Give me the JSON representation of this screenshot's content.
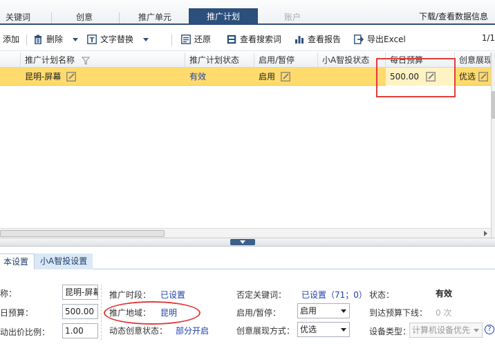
{
  "tabs": [
    {
      "label": "关键词"
    },
    {
      "label": "创意"
    },
    {
      "label": "推广单元"
    },
    {
      "label": "推广计划"
    },
    {
      "label": "账户"
    }
  ],
  "tabs_right_link": "下载/查看数据信息",
  "toolbar": {
    "add": "添加",
    "delete": "删除",
    "replace": "文字替换",
    "restore": "还原",
    "search_terms": "查看搜索词",
    "report": "查看报告",
    "export": "导出Excel",
    "pager": "1/1"
  },
  "grid": {
    "headers": [
      "推广计划名称",
      "推广计划状态",
      "启用/暂停",
      "小A智投状态",
      "每日预算",
      "创意展现"
    ],
    "row": {
      "name": "昆明-屏幕",
      "status": "有效",
      "enabled": "启用",
      "smart_status": "",
      "budget": "500.00",
      "creative": "优选"
    }
  },
  "bottom_tabs": [
    "本设置",
    "小A智投设置"
  ],
  "form": {
    "name_label": "称：",
    "name_value": "昆明-屏幕",
    "budget_label": "日预算：",
    "budget_value": "500.00",
    "bid_label": "动出价比例：",
    "bid_value": "1.00",
    "time_label": "推广时段：",
    "time_value": "已设置",
    "region_label": "推广地域：",
    "region_value": "昆明",
    "dynamic_label": "动态创意状态：",
    "dynamic_value": "部分开启",
    "negative_label": "否定关键词：",
    "negative_value": "已设置（71；0）",
    "pause_label": "启用/暂停：",
    "pause_value": "启用",
    "display_label": "创意展现方式：",
    "display_value": "优选",
    "status_label": "状态：",
    "status_value": "有效",
    "offline_label": "到达预算下线：",
    "offline_value": "0 次",
    "device_label": "设备类型：",
    "device_value": "计算机设备优先",
    "help": "?"
  },
  "colors": {
    "tab_active": "#2c4f7c",
    "row_selected": "#ffdb6d",
    "link": "#1b3fa8",
    "annotation": "#e03b3b"
  }
}
